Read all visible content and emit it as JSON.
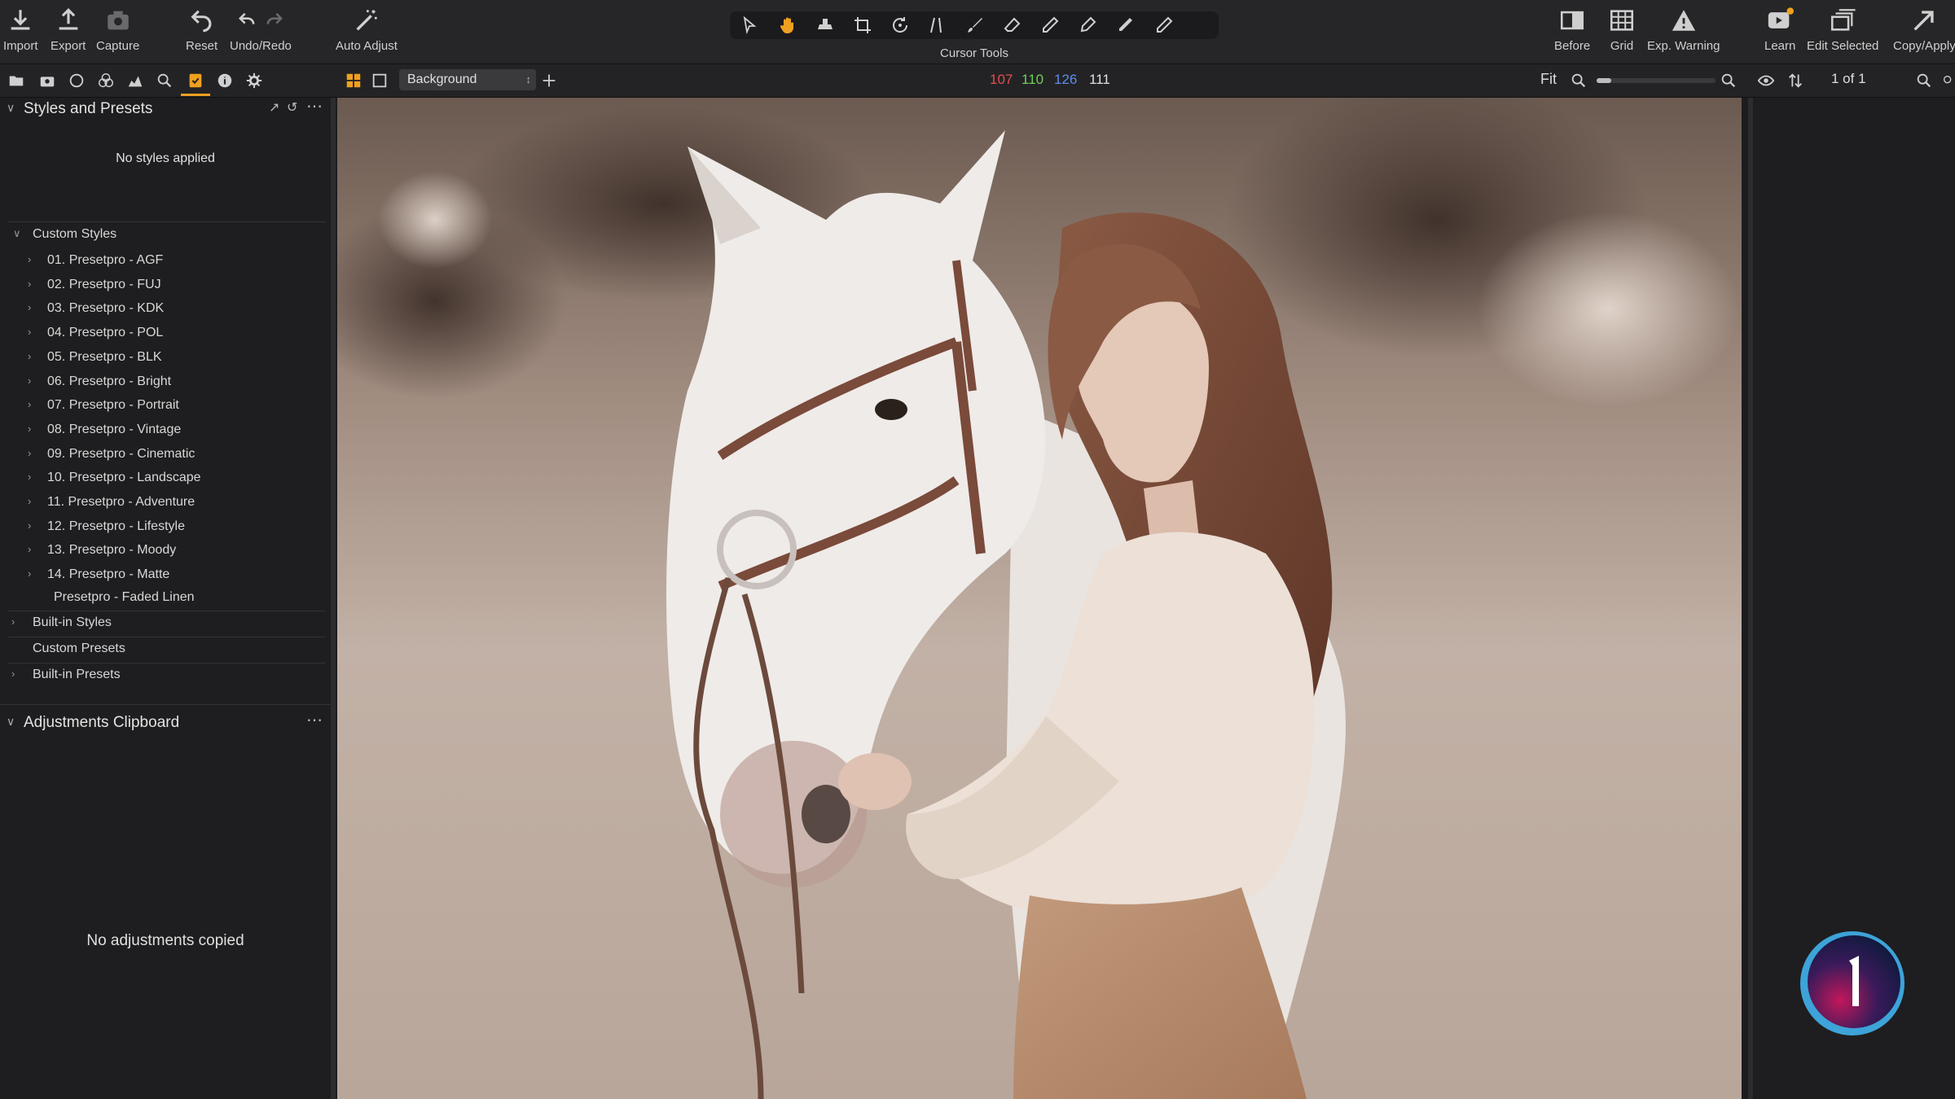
{
  "toolbar": {
    "import": "Import",
    "export": "Export",
    "capture": "Capture",
    "reset": "Reset",
    "undo_redo": "Undo/Redo",
    "auto_adjust": "Auto Adjust",
    "cursor_tools": "Cursor Tools",
    "before": "Before",
    "grid": "Grid",
    "exp_warning": "Exp. Warning",
    "learn": "Learn",
    "edit_selected": "Edit Selected",
    "copy_apply": "Copy/Apply"
  },
  "viewer": {
    "layer_select": "Background",
    "rgb": {
      "r": "107",
      "g": "110",
      "b": "126",
      "l": "111"
    },
    "fit_label": "Fit",
    "zoom_level": 0.12,
    "counter": "1 of 1"
  },
  "styles_panel": {
    "title": "Styles and Presets",
    "status": "No styles applied",
    "custom_styles_label": "Custom Styles",
    "custom_styles": [
      "01. Presetpro - AGF",
      "02. Presetpro - FUJ",
      "03. Presetpro - KDK",
      "04. Presetpro - POL",
      "05. Presetpro - BLK",
      "06. Presetpro - Bright",
      "07. Presetpro - Portrait",
      "08. Presetpro - Vintage",
      "09. Presetpro - Cinematic",
      "10. Presetpro - Landscape",
      "11. Presetpro - Adventure",
      "12. Presetpro - Lifestyle",
      "13. Presetpro - Moody",
      "14. Presetpro - Matte"
    ],
    "faded_linen": "Presetpro - Faded Linen",
    "builtin_styles": "Built-in Styles",
    "custom_presets": "Custom Presets",
    "builtin_presets": "Built-in Presets"
  },
  "clipboard_panel": {
    "title": "Adjustments Clipboard",
    "status": "No adjustments copied"
  },
  "colors": {
    "accent": "#f0a020",
    "r": "#e05050",
    "g": "#6fcf5a",
    "b": "#5f8de8"
  }
}
